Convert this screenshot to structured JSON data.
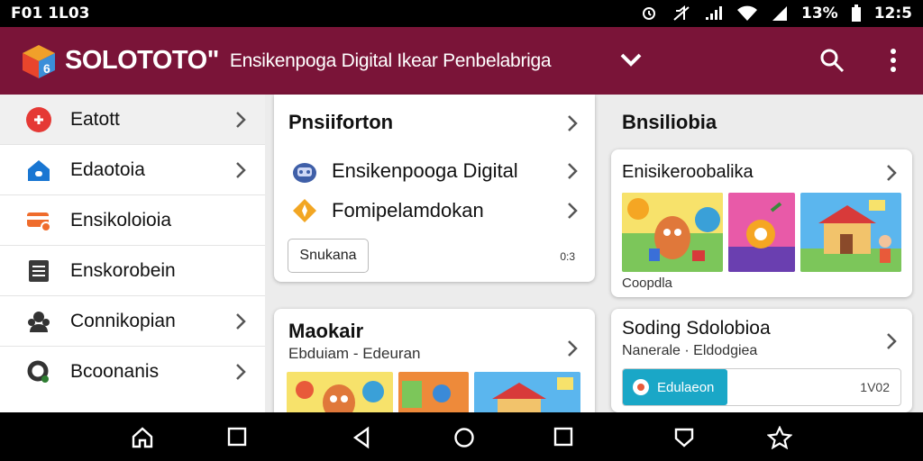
{
  "status_bar": {
    "left_text": "F01 1L03",
    "battery": "13%",
    "time": "12:5"
  },
  "app_bar": {
    "brand": "SOLOTOTO\"",
    "subtitle": "Ensikenpoga Digital Ikear Penbelabriga"
  },
  "sidebar": {
    "items": [
      {
        "label": "Eatott",
        "icon": "red-circle-icon"
      },
      {
        "label": "Edaotoia",
        "icon": "blue-house-icon"
      },
      {
        "label": "Ensikoloioia",
        "icon": "orange-card-icon"
      },
      {
        "label": "Enskorobein",
        "icon": "document-icon"
      },
      {
        "label": "Connikopian",
        "icon": "people-icon"
      },
      {
        "label": "Bcoonanis",
        "icon": "ring-icon"
      }
    ]
  },
  "card1": {
    "title": "Pnsiiforton",
    "rows": [
      {
        "label": "Ensikenpooga Digital"
      },
      {
        "label": "Fomipelamdokan"
      }
    ],
    "button": "Snukana",
    "corner": "0:3"
  },
  "section2": {
    "title": "Bnsiliobia"
  },
  "card2": {
    "title": "Enisikeroobalika",
    "caption": "Coopdla"
  },
  "card3": {
    "title": "Maokair",
    "subtitle": "Ebduiam - Edeuran"
  },
  "card4": {
    "title": "Soding Sdolobioa",
    "subtitle": "Nanerale · Eldodgiea",
    "button": "Edulaeon",
    "corner": "1V02"
  },
  "colors": {
    "app_bar": "#7a1438",
    "accent_button": "#1aa7c7"
  }
}
